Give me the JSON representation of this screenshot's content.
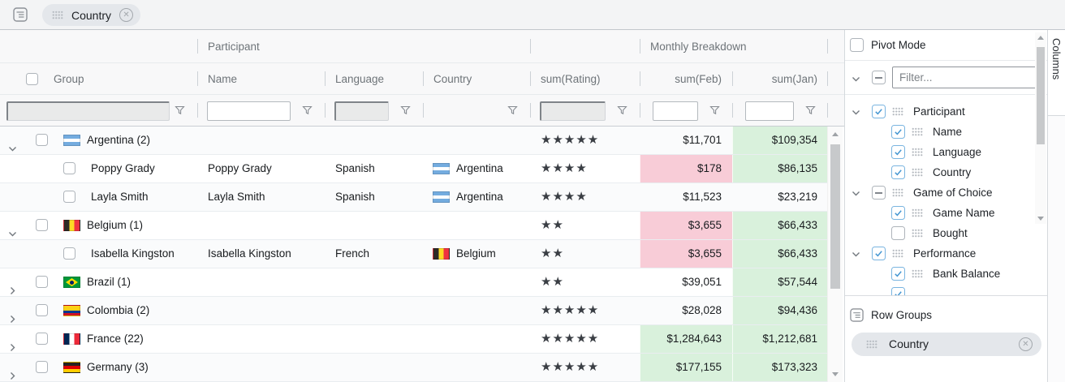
{
  "colors": {
    "pink_cell": "#f8ccd7",
    "green_cell": "#d9f1dc",
    "chip_bg": "#e4e7eb",
    "stripe_bg": "#fafbfc",
    "header_text": "#6e7479",
    "cell_text": "#181b1e",
    "checkbox_blue": "#4697d2",
    "checkbox_blue_border": "#7ab5e0"
  },
  "toolbar": {
    "chip": {
      "label": "Country"
    }
  },
  "grid": {
    "group_headers": [
      {
        "label": "Participant"
      },
      {
        "label": "Monthly Breakdown"
      }
    ],
    "columns": [
      {
        "label": "Group"
      },
      {
        "label": "Name"
      },
      {
        "label": "Language"
      },
      {
        "label": "Country"
      },
      {
        "label": "sum(Rating)"
      },
      {
        "label": "sum(Feb)"
      },
      {
        "label": "sum(Jan)"
      }
    ],
    "filters": [
      {
        "column": "Group",
        "type": "text-disabled",
        "value": ""
      },
      {
        "column": "Name",
        "type": "text",
        "value": ""
      },
      {
        "column": "Language",
        "type": "text-disabled",
        "value": ""
      },
      {
        "column": "Country",
        "type": "icon-only",
        "value": ""
      },
      {
        "column": "sum(Rating)",
        "type": "text-disabled",
        "value": ""
      },
      {
        "column": "sum(Feb)",
        "type": "number",
        "value": ""
      },
      {
        "column": "sum(Jan)",
        "type": "number",
        "value": ""
      }
    ],
    "rows": [
      {
        "type": "group",
        "expanded": true,
        "flag": "argentina",
        "label": "Argentina (2)",
        "name": "",
        "language": "",
        "country": "",
        "rating": 5,
        "feb": "$11,701",
        "feb_bg": "none",
        "jan": "$109,354",
        "jan_bg": "green"
      },
      {
        "type": "leaf",
        "group": "Poppy Grady",
        "name": "Poppy Grady",
        "language": "Spanish",
        "flag": "argentina",
        "country": "Argentina",
        "rating": 4,
        "feb": "$178",
        "feb_bg": "pink",
        "jan": "$86,135",
        "jan_bg": "green"
      },
      {
        "type": "leaf",
        "group": "Layla Smith",
        "name": "Layla Smith",
        "language": "Spanish",
        "flag": "argentina",
        "country": "Argentina",
        "rating": 4,
        "feb": "$11,523",
        "feb_bg": "none",
        "jan": "$23,219",
        "jan_bg": "none"
      },
      {
        "type": "group",
        "expanded": true,
        "flag": "belgium",
        "label": "Belgium (1)",
        "name": "",
        "language": "",
        "country": "",
        "rating": 2,
        "feb": "$3,655",
        "feb_bg": "pink",
        "jan": "$66,433",
        "jan_bg": "green"
      },
      {
        "type": "leaf",
        "group": "Isabella Kingston",
        "name": "Isabella Kingston",
        "language": "French",
        "flag": "belgium",
        "country": "Belgium",
        "rating": 2,
        "feb": "$3,655",
        "feb_bg": "pink",
        "jan": "$66,433",
        "jan_bg": "green"
      },
      {
        "type": "group",
        "expanded": false,
        "flag": "brazil",
        "label": "Brazil (1)",
        "name": "",
        "language": "",
        "country": "",
        "rating": 2,
        "feb": "$39,051",
        "feb_bg": "none",
        "jan": "$57,544",
        "jan_bg": "green"
      },
      {
        "type": "group",
        "expanded": false,
        "flag": "colombia",
        "label": "Colombia (2)",
        "name": "",
        "language": "",
        "country": "",
        "rating": 5,
        "feb": "$28,028",
        "feb_bg": "none",
        "jan": "$94,436",
        "jan_bg": "green"
      },
      {
        "type": "group",
        "expanded": false,
        "flag": "france",
        "label": "France (22)",
        "name": "",
        "language": "",
        "country": "",
        "rating": 5,
        "feb": "$1,284,643",
        "feb_bg": "green",
        "jan": "$1,212,681",
        "jan_bg": "green"
      },
      {
        "type": "group",
        "expanded": false,
        "flag": "germany",
        "label": "Germany (3)",
        "name": "",
        "language": "",
        "country": "",
        "rating": 5,
        "feb": "$177,155",
        "feb_bg": "green",
        "jan": "$173,323",
        "jan_bg": "green"
      }
    ]
  },
  "sidebar": {
    "pivot_mode": {
      "label": "Pivot Mode",
      "checked": false
    },
    "filter": {
      "placeholder": "Filter...",
      "value": ""
    },
    "expand_all_check": "indeterminate",
    "tree": [
      {
        "label": "Participant",
        "level": 0,
        "check": "checked",
        "chevron": "down"
      },
      {
        "label": "Name",
        "level": 1,
        "check": "checked"
      },
      {
        "label": "Language",
        "level": 1,
        "check": "checked"
      },
      {
        "label": "Country",
        "level": 1,
        "check": "checked"
      },
      {
        "label": "Game of Choice",
        "level": 0,
        "check": "indeterminate",
        "chevron": "down"
      },
      {
        "label": "Game Name",
        "level": 1,
        "check": "checked"
      },
      {
        "label": "Bought",
        "level": 1,
        "check": "unchecked"
      },
      {
        "label": "Performance",
        "level": 0,
        "check": "checked",
        "chevron": "down"
      },
      {
        "label": "Bank Balance",
        "level": 1,
        "check": "checked"
      },
      {
        "label": "",
        "level": 1,
        "check": "checked",
        "partial": true
      }
    ],
    "row_groups": {
      "label": "Row Groups",
      "chips": [
        {
          "label": "Country"
        }
      ]
    }
  },
  "side_tabs": [
    {
      "label": "Columns"
    }
  ]
}
